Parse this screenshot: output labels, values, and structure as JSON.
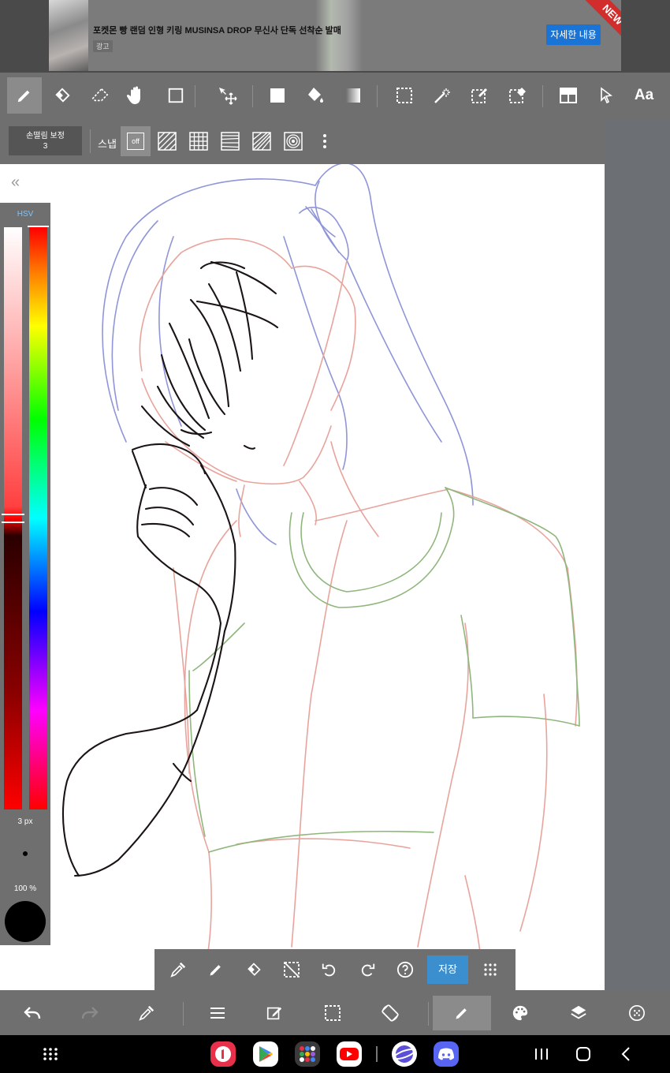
{
  "ad": {
    "text": "포켓몬 빵 랜덤 인형 키링 MUSINSA DROP 무신사 단독 선착순 발매",
    "badge": "광고",
    "button": "자세한 내용",
    "ribbon": "NEW"
  },
  "toolbar_top": {
    "tools": [
      "pen-icon",
      "eraser-icon",
      "blur-eraser-icon",
      "hand-icon",
      "rectangle-icon",
      "move-icon",
      "fill-square-icon",
      "bucket-icon",
      "gradient-icon",
      "select-rect-icon",
      "magic-wand-icon",
      "select-pen-icon",
      "select-eraser-icon",
      "layer-tone-icon",
      "pointer-icon"
    ],
    "text_tool": "Aa"
  },
  "stabilizer": {
    "label": "손떨림 보정",
    "value": "3"
  },
  "snap": {
    "label": "스냅",
    "off": "off"
  },
  "color_panel": {
    "mode": "HSV",
    "brush_size": "3 px",
    "opacity": "100 %",
    "current_color": "#000000"
  },
  "floating_bar": {
    "save": "저장"
  },
  "colors": {
    "toolbar": "#6f6f6f",
    "save_button": "#3c8fcf",
    "sketch_red": "#e8a49c",
    "sketch_blue": "#8f95d8",
    "sketch_green": "#8fb67c",
    "ink": "#1b1416"
  }
}
